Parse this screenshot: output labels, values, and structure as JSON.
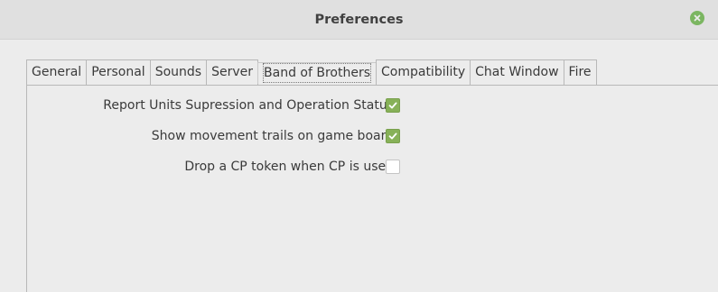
{
  "window": {
    "title": "Preferences"
  },
  "tabs": [
    {
      "label": "General"
    },
    {
      "label": "Personal"
    },
    {
      "label": "Sounds"
    },
    {
      "label": "Server"
    },
    {
      "label": "Band of Brothers",
      "active": true
    },
    {
      "label": "Compatibility"
    },
    {
      "label": "Chat Window"
    },
    {
      "label": "Fire"
    }
  ],
  "options": [
    {
      "label": "Report Units Supression and Operation Status",
      "checked": true
    },
    {
      "label": "Show movement trails on game board",
      "checked": true
    },
    {
      "label": "Drop a CP token when CP is used",
      "checked": false
    }
  ],
  "colors": {
    "accent": "#87b158",
    "close": "#7bb661"
  },
  "icons": {
    "close": "close-icon",
    "check": "checkmark-icon"
  }
}
